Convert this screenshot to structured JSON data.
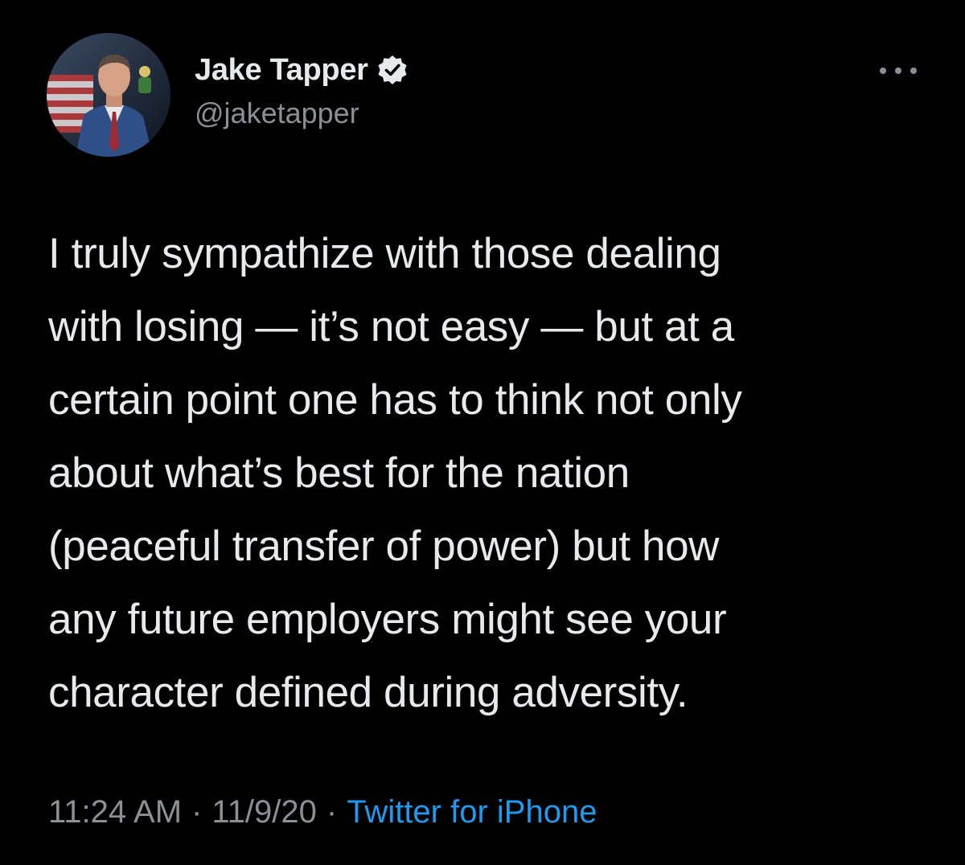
{
  "tweet": {
    "author": {
      "display_name": "Jake Tapper",
      "handle": "@jaketapper",
      "verified": true,
      "avatar_icon": "profile-photo"
    },
    "more_icon": "more-options-icon",
    "text": "I truly sympathize with those dealing\nwith losing — it’s not easy — but at a\ncertain point one has to think not only\nabout what’s best for the nation\n(peaceful transfer of power) but how\nany future employers might see your\ncharacter defined during adversity.",
    "time": "11:24 AM",
    "separator": "·",
    "date": "11/9/20",
    "source": "Twitter for iPhone"
  },
  "colors": {
    "background": "#000000",
    "primary_text": "#e7e9ea",
    "secondary_text": "#8b9096",
    "link": "#1d9bf0"
  }
}
